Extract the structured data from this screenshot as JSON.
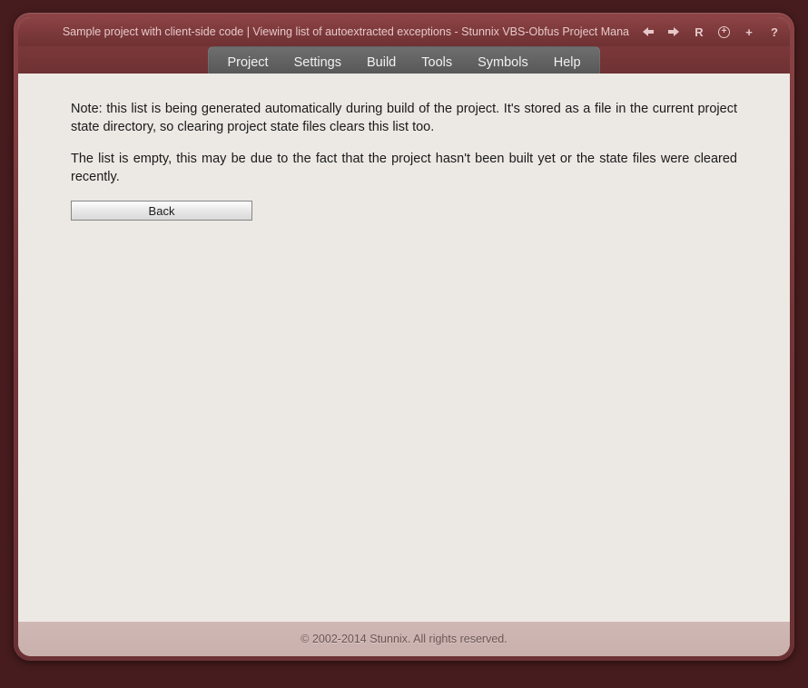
{
  "header": {
    "title": "Sample project with client-side code | Viewing list of autoextracted exceptions - Stunnix VBS-Obfus Project Mana"
  },
  "toolbar": {
    "back_icon": "back",
    "forward_icon": "forward",
    "reload_label": "R",
    "add_circle_label": "+",
    "plus_label": "+",
    "help_label": "?"
  },
  "menu": {
    "items": [
      "Project",
      "Settings",
      "Build",
      "Tools",
      "Symbols",
      "Help"
    ]
  },
  "content": {
    "note1": "Note: this list is being generated automatically during build of the project. It's stored as a file in the current project state directory, so clearing project state files clears this list too.",
    "note2": "The list is empty, this may be due to the fact that the project hasn't been built yet or the state files were cleared recently.",
    "back_button": "Back"
  },
  "footer": {
    "copyright": "© 2002-2014 Stunnix. All rights reserved."
  }
}
